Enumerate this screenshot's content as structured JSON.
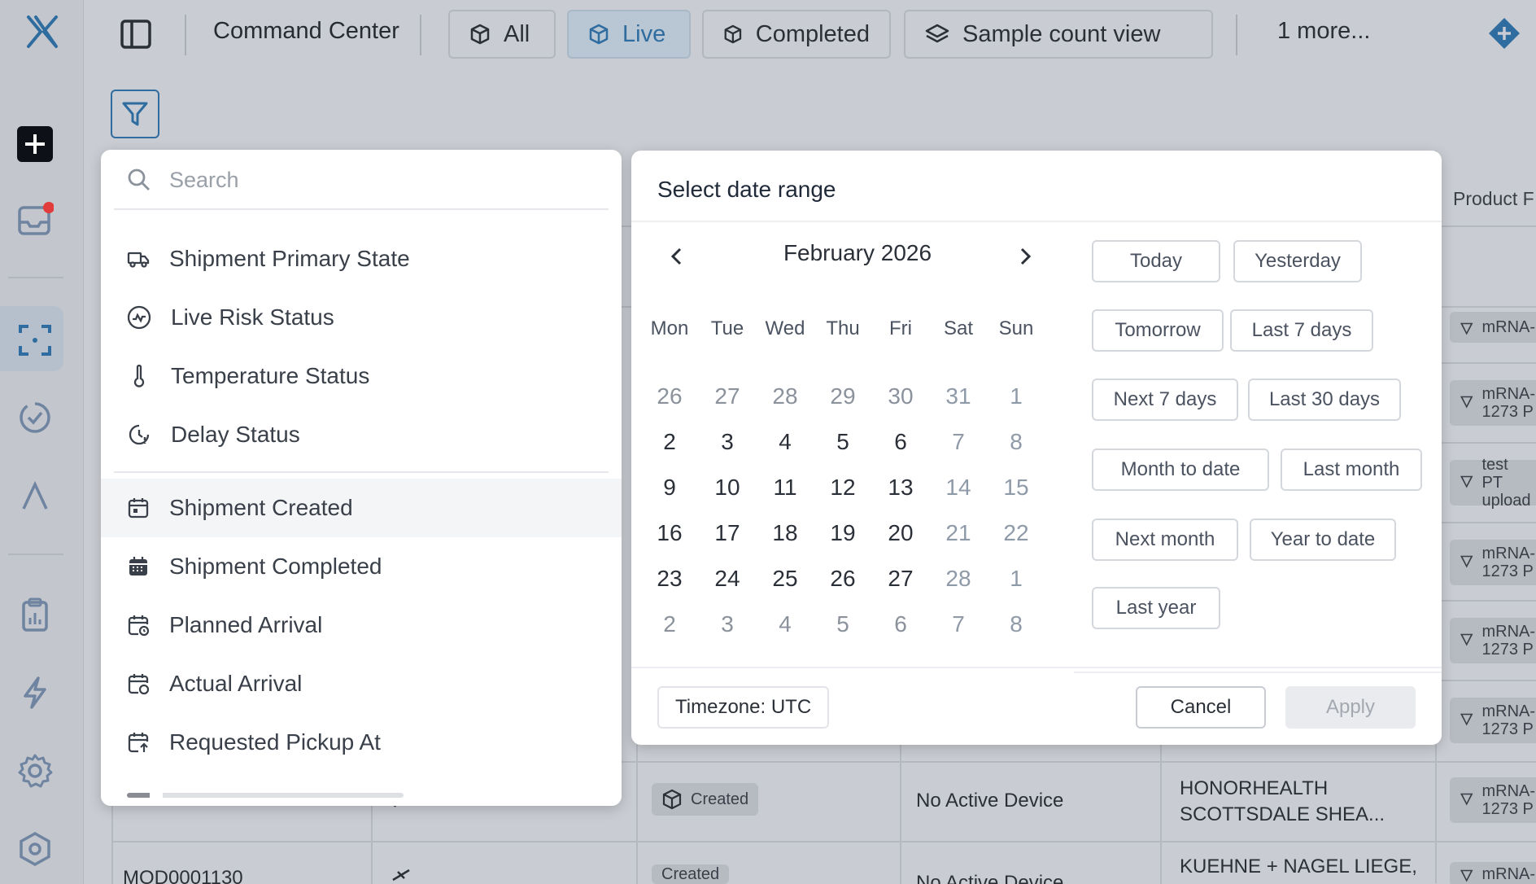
{
  "header": {
    "title": "Command Center",
    "tabs": [
      {
        "label": "All",
        "icon": "box-icon"
      },
      {
        "label": "Live",
        "icon": "box-icon",
        "active": true
      },
      {
        "label": "Completed",
        "icon": "box-icon"
      },
      {
        "label": "Sample count view",
        "icon": "layers-icon"
      }
    ],
    "more_label": "1 more..."
  },
  "sidebar": {
    "items": [
      "logo",
      "add",
      "inbox",
      "scan",
      "check-circle",
      "lambda",
      "clipboard",
      "bolt",
      "settings",
      "hexagon"
    ]
  },
  "filter_menu": {
    "search_placeholder": "Search",
    "status_items": [
      {
        "label": "Shipment Primary State",
        "icon": "truck-icon"
      },
      {
        "label": "Live Risk Status",
        "icon": "pulse-icon"
      },
      {
        "label": "Temperature Status",
        "icon": "thermometer-icon"
      },
      {
        "label": "Delay Status",
        "icon": "clock-icon"
      }
    ],
    "date_items": [
      {
        "label": "Shipment Created",
        "icon": "calendar-icon"
      },
      {
        "label": "Shipment Completed",
        "icon": "calendar-filled-icon"
      },
      {
        "label": "Planned Arrival",
        "icon": "calendar-clock-icon"
      },
      {
        "label": "Actual Arrival",
        "icon": "calendar-check-icon"
      },
      {
        "label": "Requested Pickup At",
        "icon": "calendar-arrow-icon"
      }
    ]
  },
  "date_picker": {
    "title": "Select date range",
    "month_label": "February 2026",
    "weekdays": [
      "Mon",
      "Tue",
      "Wed",
      "Thu",
      "Fri",
      "Sat",
      "Sun"
    ],
    "weeks": [
      [
        "26",
        "27",
        "28",
        "29",
        "30",
        "31",
        "1"
      ],
      [
        "2",
        "3",
        "4",
        "5",
        "6",
        "7",
        "8"
      ],
      [
        "9",
        "10",
        "11",
        "12",
        "13",
        "14",
        "15"
      ],
      [
        "16",
        "17",
        "18",
        "19",
        "20",
        "21",
        "22"
      ],
      [
        "23",
        "24",
        "25",
        "26",
        "27",
        "28",
        "1"
      ],
      [
        "2",
        "3",
        "4",
        "5",
        "6",
        "7",
        "8"
      ]
    ],
    "presets": [
      "Today",
      "Yesterday",
      "Tomorrow",
      "Last 7 days",
      "Next 7 days",
      "Last 30 days",
      "Month to date",
      "Last month",
      "Next month",
      "Year to date",
      "Last year"
    ],
    "timezone_label": "Timezone: UTC",
    "cancel_label": "Cancel",
    "apply_label": "Apply"
  },
  "table_bg": {
    "header_product": "Product F",
    "status_badge": "Created",
    "device_text": "No Active Device",
    "row_id": "MOD0001130",
    "destination_1": "HONORHEALTH SCOTTSDALE SHEA...",
    "destination_2": "KUEHNE + NAGEL LIEGE,",
    "products": [
      "mRNA-",
      "mRNA-\n1273 P",
      "test PT\nupload",
      "mRNA-\n1273 P",
      "mRNA-\n1273 P",
      "mRNA-\n1273 P",
      "mRNA-\n1273 P",
      "mRNA-"
    ]
  },
  "colors": {
    "accent": "#2f6c9f",
    "notification_dot": "#e23b3b",
    "overlay_bg": "#c9ccd2"
  }
}
